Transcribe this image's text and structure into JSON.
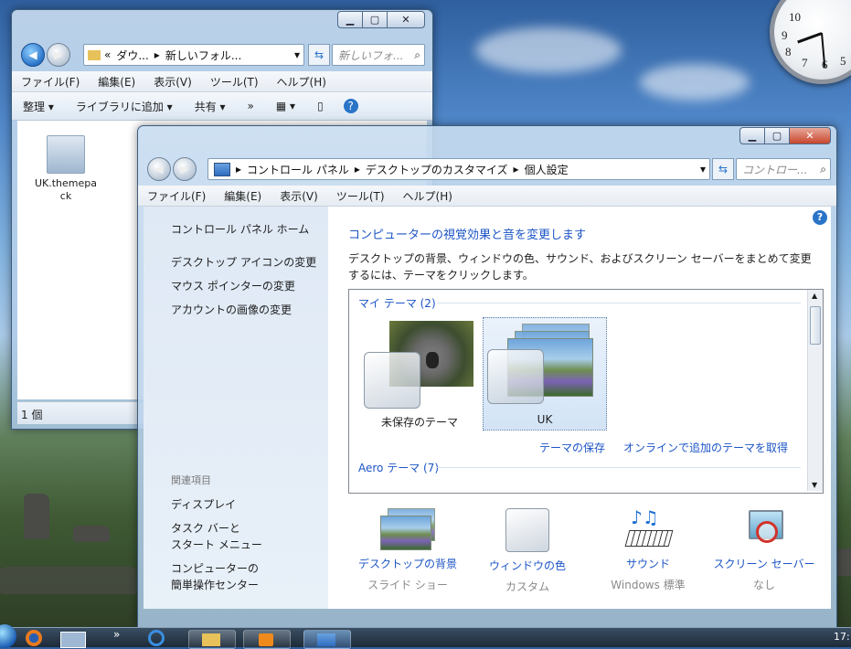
{
  "desktop": {
    "taskbar_time": "17:"
  },
  "explorer": {
    "address_parts": [
      "«",
      "ダウ...",
      "新しいフォル..."
    ],
    "search_placeholder": "新しいフォ...",
    "menu": [
      "ファイル(F)",
      "編集(E)",
      "表示(V)",
      "ツール(T)",
      "ヘルプ(H)"
    ],
    "toolbar": {
      "organize": "整理 ▾",
      "add_to_library": "ライブラリに追加 ▾",
      "share": "共有 ▾",
      "more": "»"
    },
    "file_name": "UK.themepack",
    "status": "1 個"
  },
  "control_panel": {
    "breadcrumb": [
      "コントロール パネル",
      "デスクトップのカスタマイズ",
      "個人設定"
    ],
    "search_placeholder": "コントロー...",
    "menu": [
      "ファイル(F)",
      "編集(E)",
      "表示(V)",
      "ツール(T)",
      "ヘルプ(H)"
    ],
    "left_links": [
      "コントロール パネル ホーム",
      "デスクトップ アイコンの変更",
      "マウス ポインターの変更",
      "アカウントの画像の変更"
    ],
    "related_header": "関連項目",
    "related_links": [
      "ディスプレイ",
      "タスク バーと\nスタート メニュー",
      "コンピューターの\n簡単操作センター"
    ],
    "heading": "コンピューターの視覚効果と音を変更します",
    "description": "デスクトップの背景、ウィンドウの色、サウンド、およびスクリーン セーバーをまとめて変更するには、テーマをクリックします。",
    "my_themes_label": "マイ テーマ (2)",
    "themes": [
      {
        "name": "未保存のテーマ"
      },
      {
        "name": "UK"
      }
    ],
    "save_theme": "テーマの保存",
    "get_more_online": "オンラインで追加のテーマを取得",
    "aero_themes_label": "Aero テーマ (7)",
    "bottom_items": [
      {
        "title": "デスクトップの背景",
        "sub": "スライド ショー"
      },
      {
        "title": "ウィンドウの色",
        "sub": "カスタム"
      },
      {
        "title": "サウンド",
        "sub": "Windows 標準"
      },
      {
        "title": "スクリーン セーバー",
        "sub": "なし"
      }
    ]
  },
  "colors": {
    "link_blue": "#1c55c6",
    "aero_frame": "#b8d0ea"
  }
}
